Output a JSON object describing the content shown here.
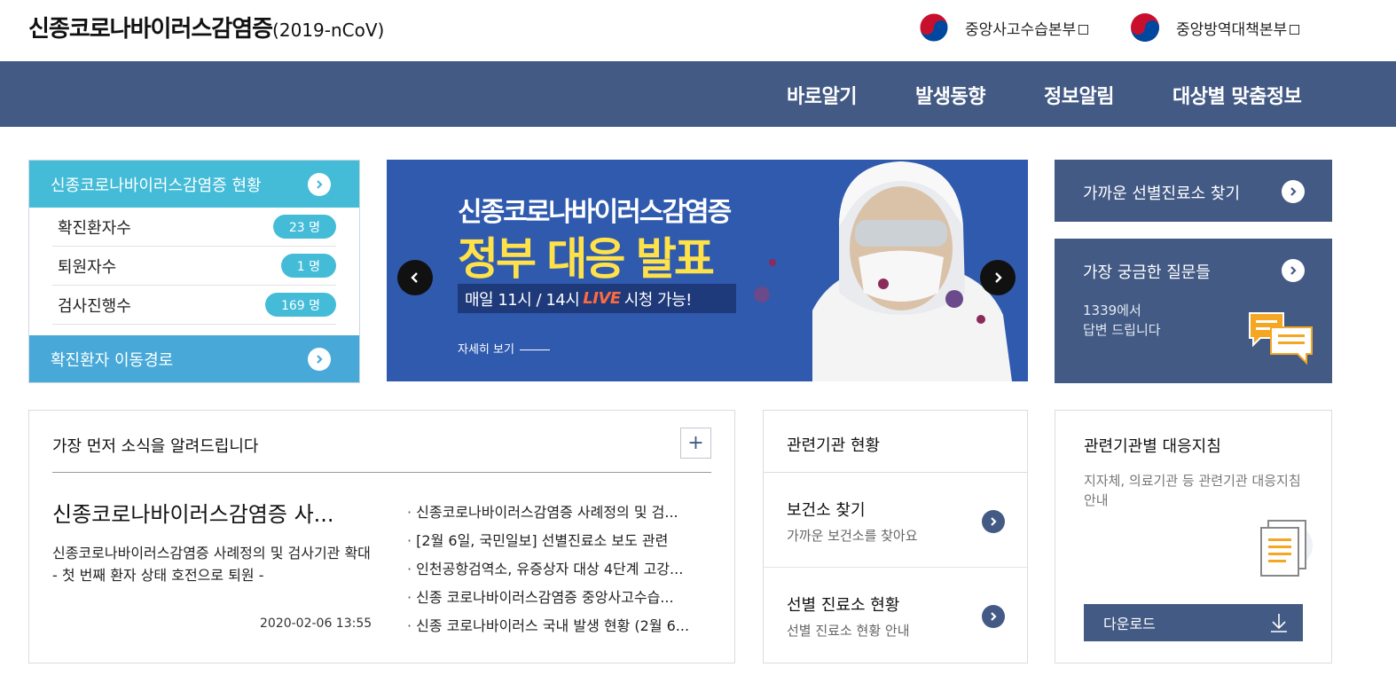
{
  "header": {
    "title": "신종코로나바이러스감염증",
    "title_sub": "(2019-nCoV)",
    "agencies": [
      {
        "label": "중앙사고수습본부"
      },
      {
        "label": "중앙방역대책본부"
      }
    ]
  },
  "nav": {
    "items": [
      "바로알기",
      "발생동향",
      "정보알림",
      "대상별 맞춤정보"
    ]
  },
  "status": {
    "title": "신종코로나바이러스감염증 현황",
    "rows": [
      {
        "label": "확진환자수",
        "value": "23 명"
      },
      {
        "label": "퇴원자수",
        "value": "1 명"
      },
      {
        "label": "검사진행수",
        "value": "169 명"
      }
    ],
    "route_label": "확진환자 이동경로"
  },
  "banner": {
    "line1": "신종코로나바이러스감염증",
    "line2": "정부 대응 발표",
    "sub_before": "매일 11시 / 14시",
    "sub_live": "LIVE",
    "sub_after": "시청 가능!",
    "more": "자세히 보기"
  },
  "tiles": {
    "clinic_title": "가까운 선별진료소 찾기",
    "faq_title": "가장 궁금한 질문들",
    "faq_desc_1": "1339에서",
    "faq_desc_2": "답변 드립니다"
  },
  "news": {
    "heading": "가장 먼저 소식을 알려드립니다",
    "plus": "+",
    "feature_title": "신종코로나바이러스감염증 사...",
    "feature_body_1": "신종코로나바이러스감염증 사례정의 및 검사기관 확대",
    "feature_body_2": "- 첫 번째 환자 상태 호전으로 퇴원 -",
    "feature_date": "2020-02-06 13:55",
    "list": [
      "신종코로나바이러스감염증 사례정의 및 검...",
      "[2월 6일, 국민일보] 선별진료소 보도 관련",
      "인천공항검역소, 유증상자 대상 4단계 고강...",
      "신종 코로나바이러스감염증 중앙사고수습...",
      "신종 코로나바이러스 국내 발생 현황 (2월 6..."
    ]
  },
  "agencies_box": {
    "heading": "관련기관 현황",
    "items": [
      {
        "title": "보건소 찾기",
        "desc": "가까운 보건소를 찾아요"
      },
      {
        "title": "선별 진료소 현황",
        "desc": "선별 진료소 현황 안내"
      }
    ]
  },
  "guide": {
    "heading": "관련기관별 대응지침",
    "desc": "지자체, 의료기관 등 관련기관 대응지침 안내",
    "download": "다운로드"
  },
  "colors": {
    "navy": "#435a85",
    "cyan": "#44bcd8",
    "route_blue": "#48a9d8",
    "banner_blue": "#2f5aae",
    "banner_yellow": "#ffe14a",
    "live_orange": "#ff6a3d"
  }
}
